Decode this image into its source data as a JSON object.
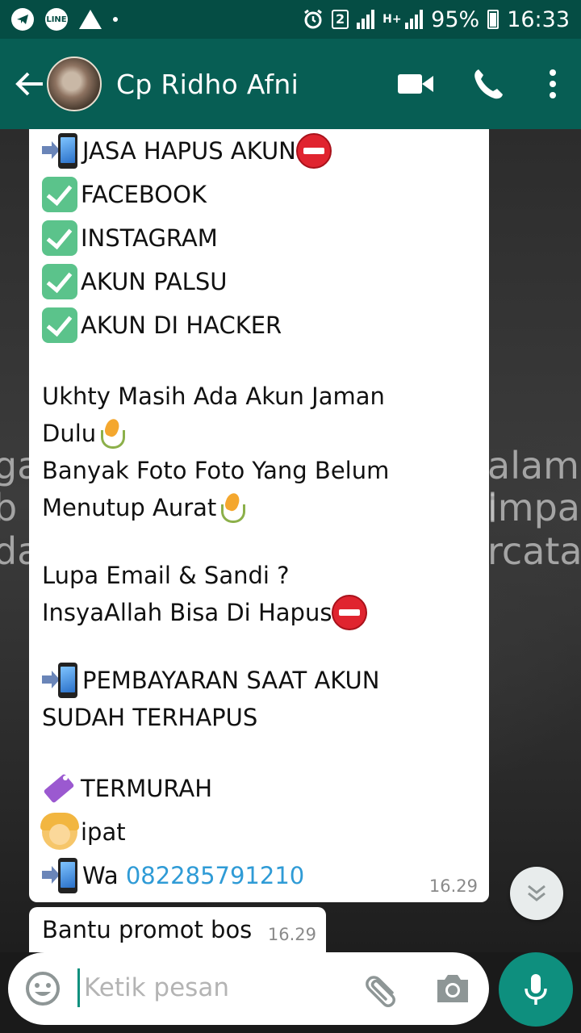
{
  "status_bar": {
    "line_label": "LINE",
    "sim_slot": "2",
    "network": "H+",
    "battery": "95%",
    "time": "16:33"
  },
  "header": {
    "contact_name": "Cp Ridho Afni",
    "icons": [
      "back-arrow-icon",
      "video-call-icon",
      "voice-call-icon",
      "more-vert-icon"
    ]
  },
  "background_text": {
    "left_1": "ga",
    "left_2": "b",
    "left_3": "da",
    "right_1": "alam l",
    "right_2": "impar",
    "right_3": "rcata"
  },
  "messages": [
    {
      "lines": {
        "l1": "JASA HAPUS AKUN",
        "l2": "FACEBOOK",
        "l3": "INSTAGRAM",
        "l4": "AKUN PALSU",
        "l5": "AKUN DI HACKER",
        "l6": "Ukhty Masih Ada Akun Jaman",
        "l7": "Dulu",
        "l8": "Banyak Foto Foto Yang Belum",
        "l9": "Menutup Aurat",
        "l10": "Lupa Email & Sandi ?",
        "l11": "InsyaAllah Bisa Di Hapus",
        "l12": "PEMBAYARAN SAAT AKUN",
        "l13": "SUDAH TERHAPUS",
        "l14": "TERMURAH",
        "l15": "ipat",
        "l16_prefix": "Wa ",
        "l16_phone": "082285791210"
      },
      "time": "16.29"
    },
    {
      "text": "Bantu promot bos",
      "time": "16.29"
    }
  ],
  "composer": {
    "placeholder": "Ketik pesan",
    "icons": [
      "emoji-icon",
      "attach-icon",
      "camera-icon",
      "mic-icon"
    ]
  },
  "colors": {
    "status_bar": "#054d44",
    "header": "#075e54",
    "accent": "#0e8f7e",
    "link": "#2f9bd6"
  }
}
